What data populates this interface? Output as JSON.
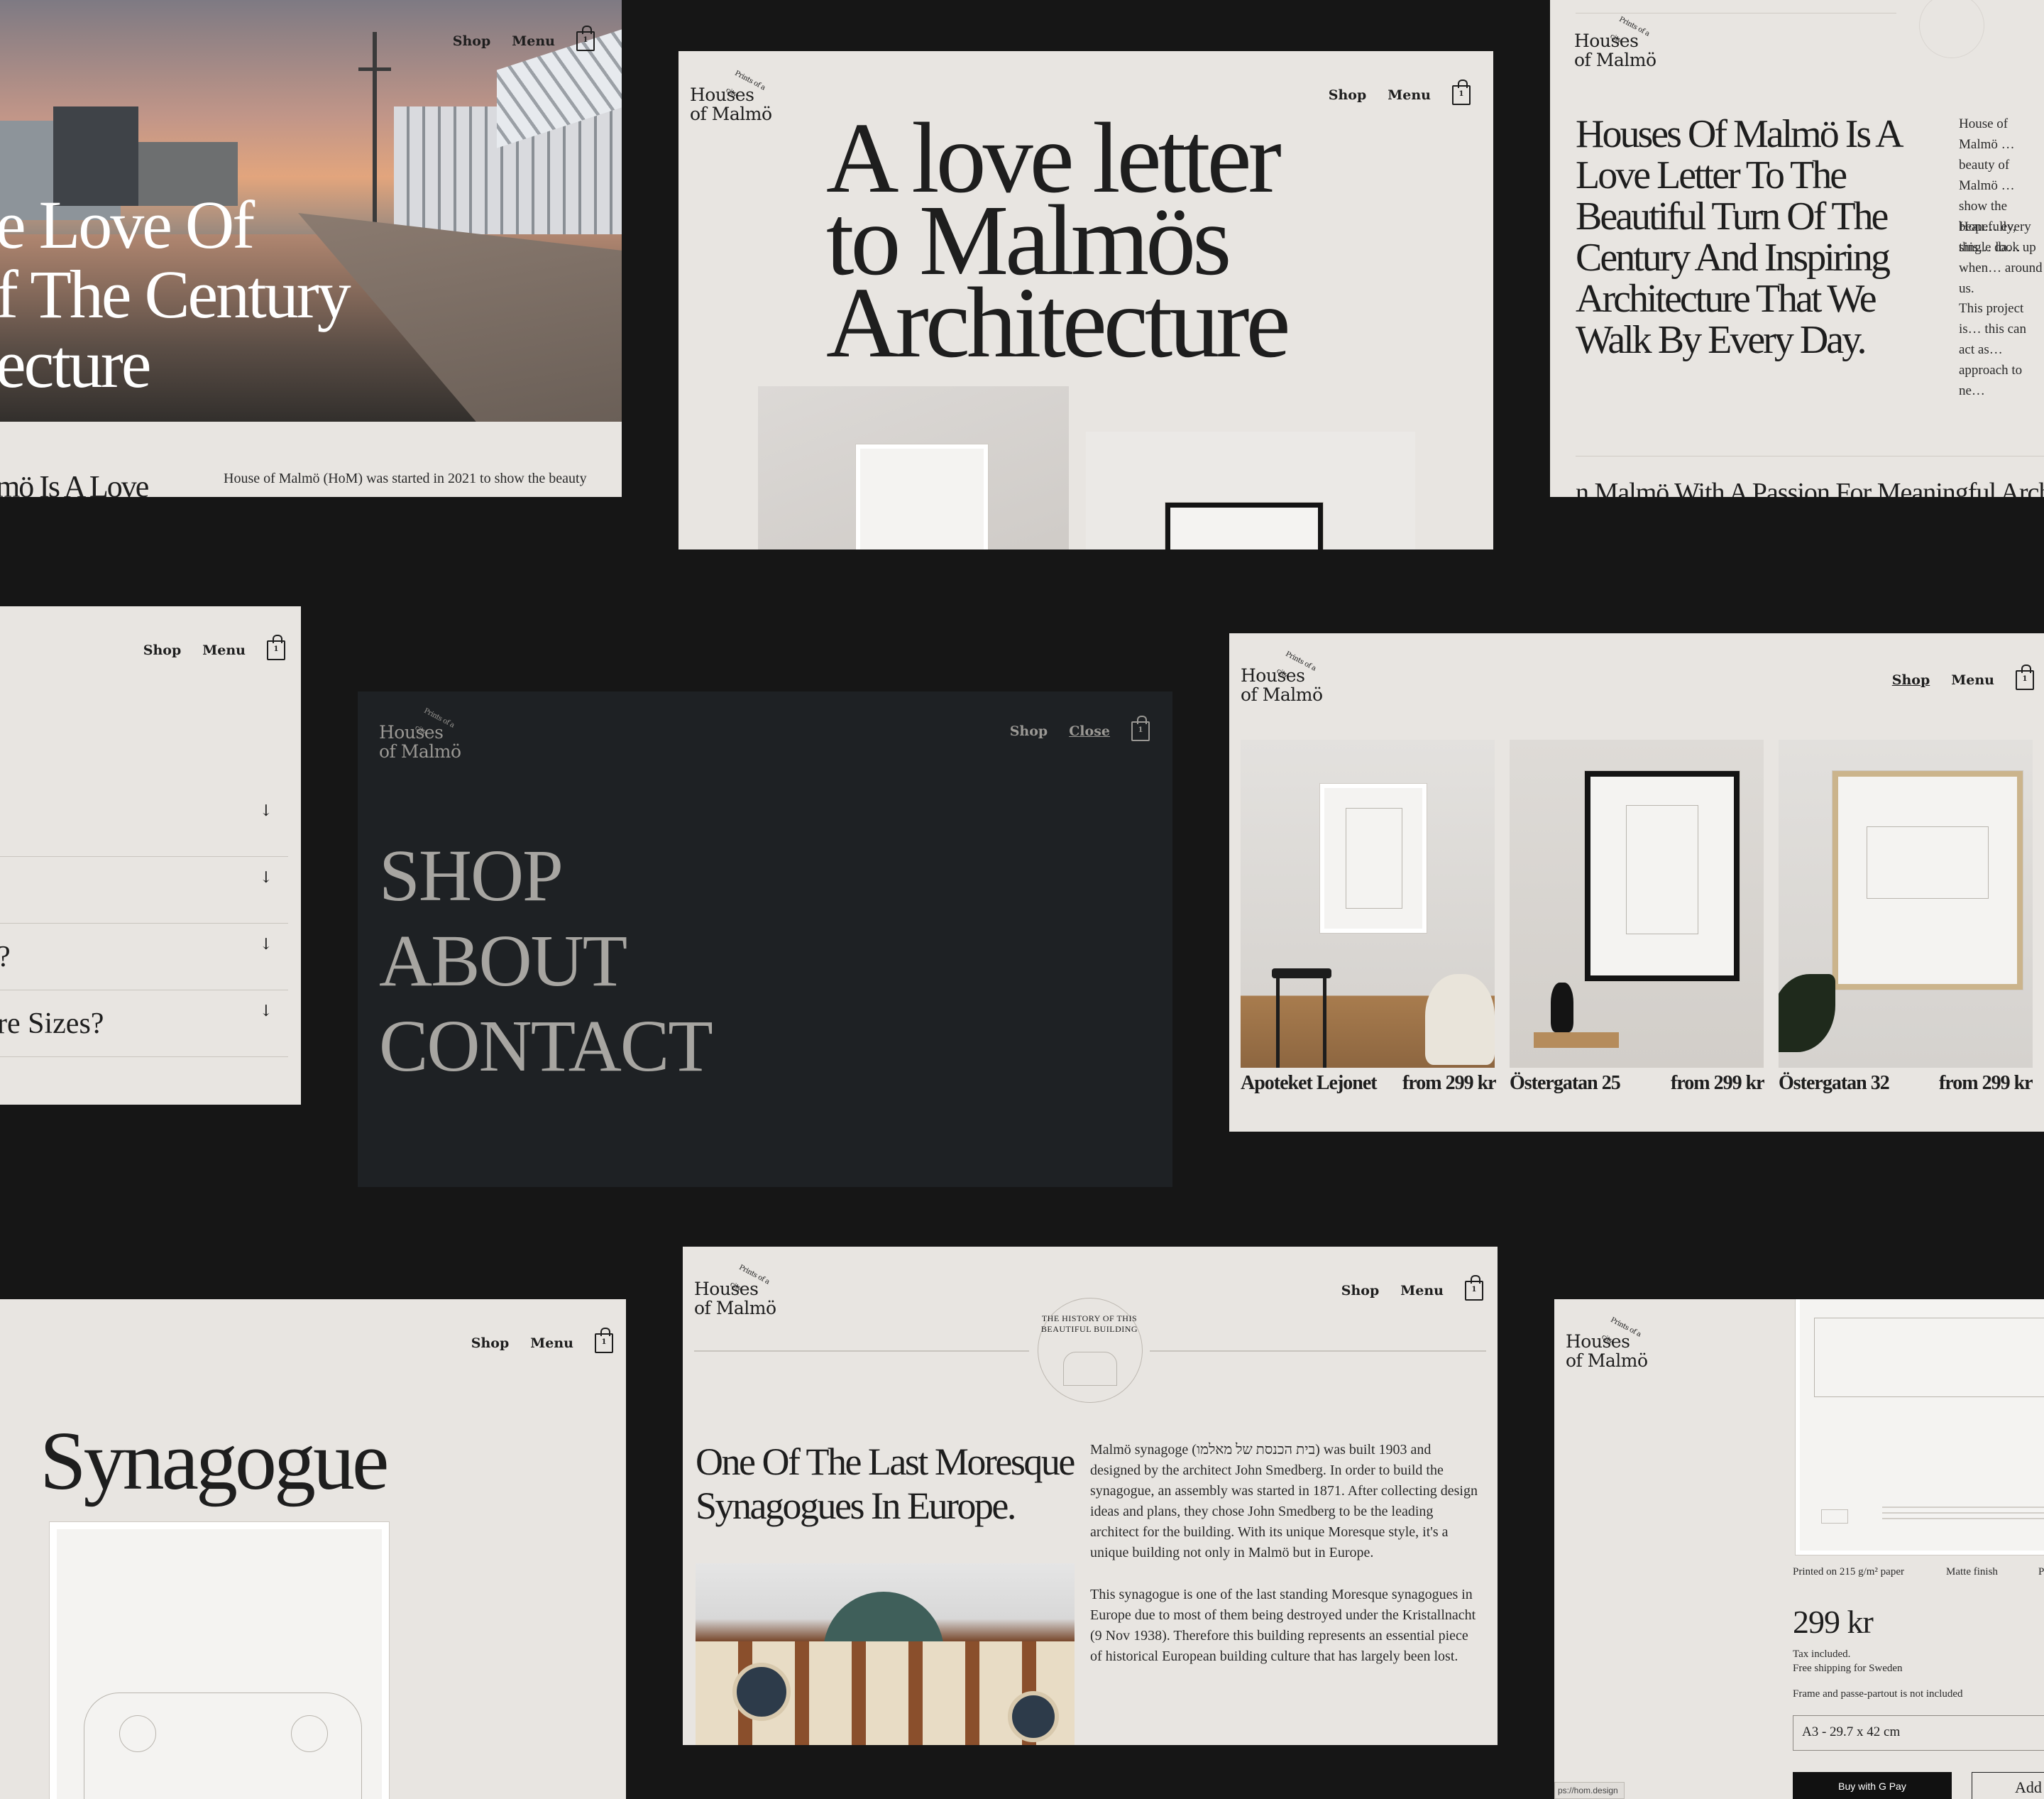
{
  "nav": {
    "shop": "Shop",
    "menu": "Menu",
    "close": "Close",
    "cart_count": "1"
  },
  "logo": {
    "line1": "Houses",
    "line2": "of Malmö",
    "tagline": "Prints of a city"
  },
  "hero_photo": {
    "title_lines": [
      "e Love Of",
      "f The Century",
      "ecture"
    ],
    "subheading": "mö Is A Love",
    "intro": "House of Malmö (HoM) was started in 2021 to show the beauty"
  },
  "love_letter": {
    "lines": [
      "A love letter",
      "to Malmös",
      "Architecture"
    ]
  },
  "about": {
    "heading": "Houses Of Malmö Is A Love Letter To The Beautiful Turn Of The Century And Inspiring Architecture That We Walk By Every Day.",
    "p1": "House of Malmö … beauty of Malmö … show the beau… every single da…",
    "p2": "Hopefully, this… look up when… around us.",
    "p3": "This project is… this can act as… approach to ne…",
    "footer_line": "n Malmö With A Passion For Meaningful Arch"
  },
  "faq": {
    "items": [
      "",
      "",
      "?",
      "re Sizes?"
    ]
  },
  "menu_overlay": {
    "items": [
      "SHOP",
      "ABOUT",
      "CONTACT"
    ]
  },
  "products": [
    {
      "name": "Apoteket Lejonet",
      "price": "from 299 kr"
    },
    {
      "name": "Östergatan 25",
      "price": "from 299 kr"
    },
    {
      "name": "Östergatan 32",
      "price": "from 299 kr"
    }
  ],
  "synagogue_page": {
    "title": "Synagogue"
  },
  "history": {
    "badge": "THE HISTORY OF THIS BEAUTIFUL BUILDING",
    "heading": "One Of The Last Moresque Synagogues In Europe.",
    "p1": "Malmö synagoge (בית הכנסת של מאלמו) was built 1903 and designed by the architect John Smedberg. In order to build the synagogue, an assembly was started in 1871. After collecting design ideas and plans, they chose John Smedberg to be the leading architect for the building. With its unique Moresque style, it's a unique building not only in Malmö but in Europe.",
    "p2": "This synagogue is one of the last standing Moresque synagogues in Europe due to most of them being destroyed under the Kristallnacht (9 Nov 1938). Therefore this building represents an essential piece of historical European building culture that has largely been lost."
  },
  "product_page": {
    "spec1": "Printed on 215 g/m² paper",
    "spec2": "Matte finish",
    "spec3": "P",
    "price": "299 kr",
    "tax": "Tax included.",
    "shipping": "Free shipping for Sweden",
    "frame_note": "Frame and passe-partout is not included",
    "size": "A3 - 29.7 x 42 cm",
    "gpay": "Buy with G Pay",
    "add": "Add",
    "url": "ps://hom.design"
  },
  "colors": {
    "background": "#161616",
    "paper": "#e8e5e1",
    "dark_panel": "#1e2124",
    "ink": "#1e1e1e"
  }
}
